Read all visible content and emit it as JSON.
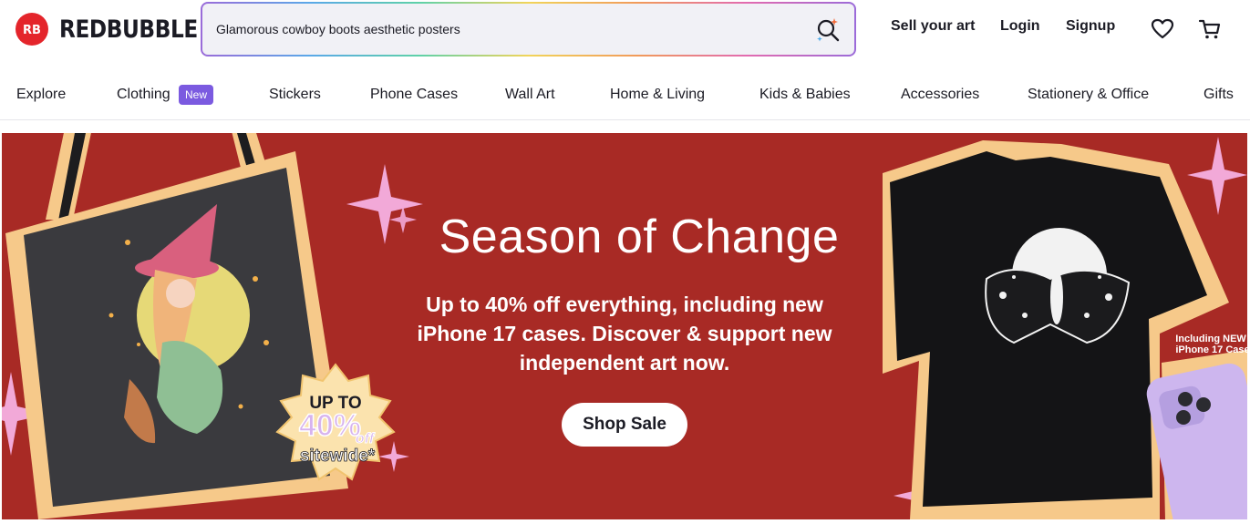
{
  "header": {
    "brand": "REDBUBBLE",
    "brand_mark": "RB",
    "search_value": "Glamorous cowboy boots aesthetic posters",
    "sell_label": "Sell your art",
    "login_label": "Login",
    "signup_label": "Signup",
    "icons": [
      "search-icon",
      "heart-icon",
      "cart-icon"
    ]
  },
  "categories": [
    {
      "label": "Explore"
    },
    {
      "label": "Clothing",
      "badge": "New"
    },
    {
      "label": "Stickers"
    },
    {
      "label": "Phone Cases"
    },
    {
      "label": "Wall Art"
    },
    {
      "label": "Home & Living"
    },
    {
      "label": "Kids & Babies"
    },
    {
      "label": "Accessories"
    },
    {
      "label": "Stationery & Office"
    },
    {
      "label": "Gifts"
    }
  ],
  "hero": {
    "title": "Season of Change",
    "subtitle": "Up to 40% off everything, including new iPhone 17 cases. Discover & support new independent art now.",
    "cta": "Shop Sale",
    "badge_line1": "UP TO",
    "badge_line2": "40%",
    "badge_line3": "off",
    "badge_line4": "sitewide*",
    "phone_note_1": "Including NEW",
    "phone_note_2": "iPhone 17 Case",
    "colors": {
      "background": "#a82a25",
      "frame": "#f6c98a",
      "star": "#f2a9d8"
    }
  }
}
